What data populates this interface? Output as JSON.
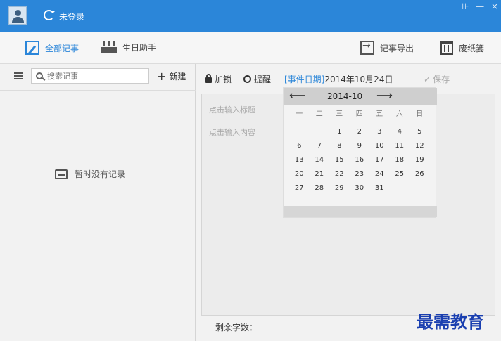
{
  "titlebar": {
    "login_status": "未登录",
    "window_controls": [
      "⊪",
      "—",
      "×"
    ]
  },
  "toolbar": {
    "all_notes": "全部记事",
    "birthday": "生日助手",
    "export": "记事导出",
    "trash": "废纸篓"
  },
  "left": {
    "search_placeholder": "搜索记事",
    "new_label": "新建",
    "empty_text": "暂时没有记录"
  },
  "right": {
    "lock_label": "加锁",
    "remind_label": "提醒",
    "event_tag": "[事件日期]",
    "event_date": "2014年10月24日",
    "save_label": "保存",
    "title_placeholder": "点击输入标题",
    "content_placeholder": "点击输入内容",
    "remaining_label": "剩余字数："
  },
  "calendar": {
    "prev": "⟵",
    "next": "⟶",
    "month": "2014-10",
    "weekdays": [
      "一",
      "二",
      "三",
      "四",
      "五",
      "六",
      "日"
    ],
    "weeks": [
      [
        "",
        "",
        "1",
        "2",
        "3",
        "4",
        "5"
      ],
      [
        "6",
        "7",
        "8",
        "9",
        "10",
        "11",
        "12"
      ],
      [
        "13",
        "14",
        "15",
        "16",
        "17",
        "18",
        "19"
      ],
      [
        "20",
        "21",
        "22",
        "23",
        "24",
        "25",
        "26"
      ],
      [
        "27",
        "28",
        "29",
        "30",
        "31",
        "",
        ""
      ]
    ]
  },
  "watermark": "最需教育",
  "colors": {
    "accent": "#2b86d9"
  }
}
